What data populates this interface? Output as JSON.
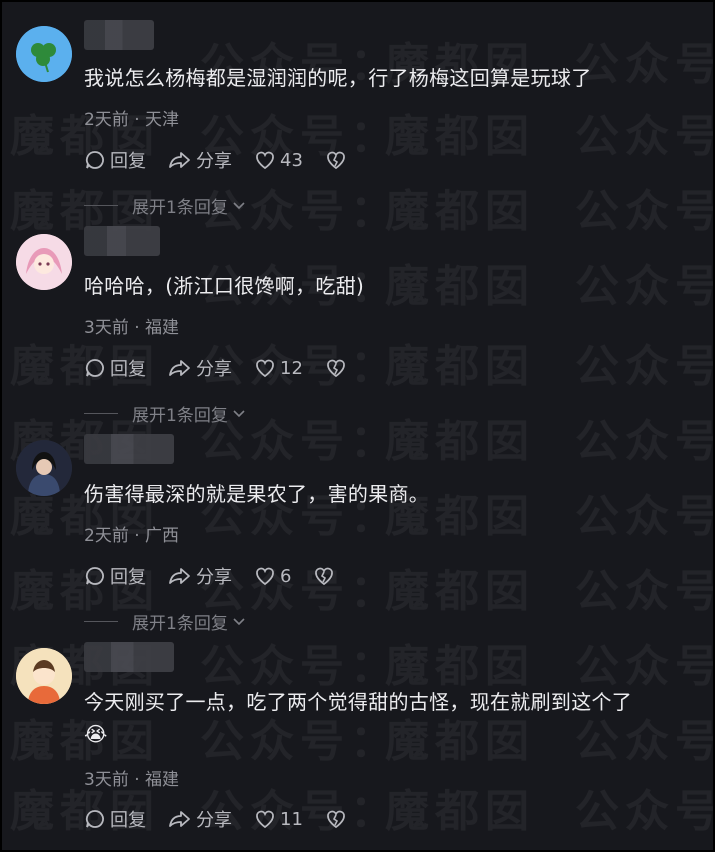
{
  "comments": [
    {
      "text": "我说怎么杨梅都是湿润润的呢，行了杨梅这回算是玩球了",
      "time": "2天前",
      "location": "天津",
      "reply_label": "回复",
      "share_label": "分享",
      "likes": "43",
      "expand": "展开1条回复"
    },
    {
      "text": "哈哈哈，(浙江口很馋啊，吃甜)",
      "time": "3天前",
      "location": "福建",
      "reply_label": "回复",
      "share_label": "分享",
      "likes": "12",
      "expand": "展开1条回复"
    },
    {
      "text": "伤害得最深的就是果农了，害的果商。",
      "time": "2天前",
      "location": "广西",
      "reply_label": "回复",
      "share_label": "分享",
      "likes": "6",
      "expand": "展开1条回复"
    },
    {
      "text": "今天刚买了一点，吃了两个觉得甜的古怪，现在就刷到这个了",
      "emoji": "😭",
      "time": "3天前",
      "location": "福建",
      "reply_label": "回复",
      "share_label": "分享",
      "likes": "11"
    }
  ],
  "meta_separator": "·",
  "watermark": {
    "a": "魔都囡",
    "b": "公众号："
  },
  "colors": {
    "background": "#17181d",
    "text": "#ececef",
    "muted": "#8f9097"
  }
}
